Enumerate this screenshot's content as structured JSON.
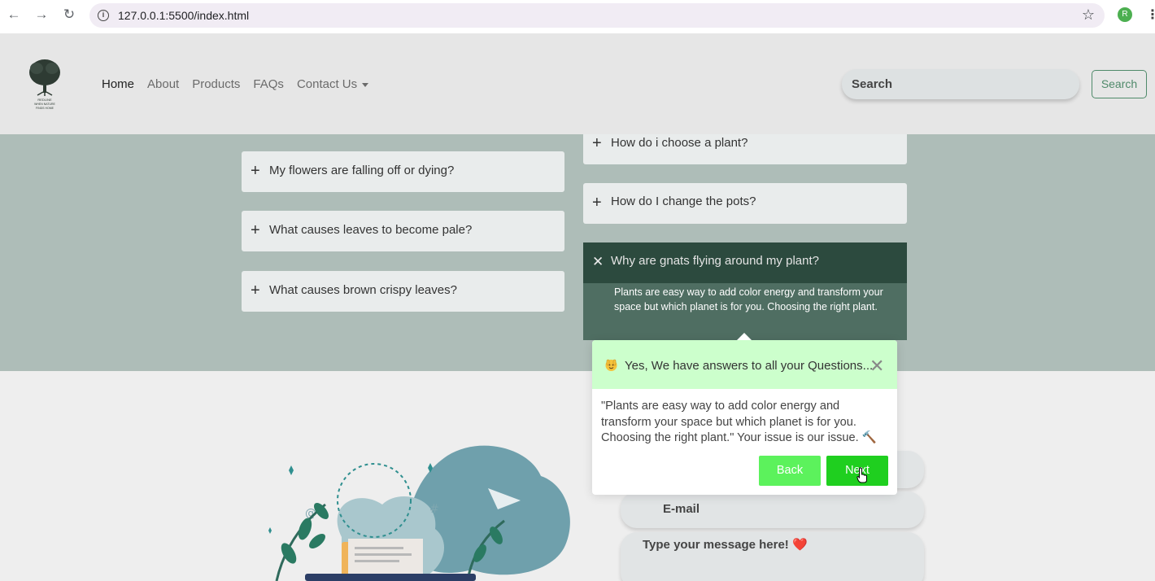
{
  "browser": {
    "url": "127.0.0.1:5500/index.html",
    "profile_initial": "R"
  },
  "nav": {
    "logo_text_1": "REDLINE",
    "logo_text_2": "WHEN NATURE",
    "logo_text_3": "FINDS HOME",
    "links": [
      "Home",
      "About",
      "Products",
      "FAQs",
      "Contact Us"
    ],
    "search_placeholder": "Search",
    "search_button": "Search"
  },
  "faqs": {
    "left": [
      "My flowers are falling off or dying?",
      "What causes leaves to become pale?",
      "What causes brown crispy leaves?"
    ],
    "right": [
      "How do i choose a plant?",
      "How do I change the pots?"
    ],
    "open_question": "Why are gnats flying around my plant?",
    "open_answer": "Plants are easy way to add color energy and transform your space but which planet is for you. Choosing the right plant."
  },
  "contact": {
    "email_placeholder": "E-mail",
    "message_placeholder": "Type your message here! ❤️"
  },
  "tour": {
    "title": "Yes, We have answers to all your Questions...",
    "body": "\"Plants are easy way to add color energy and transform your space but which planet is for you. Choosing the right plant.\" Your issue is our issue. 🔨",
    "back_label": "Back",
    "next_label": "Next",
    "colors": {
      "header_bg": "#ccffcc",
      "back_bg": "#5cf25c",
      "next_bg": "#1fcf1f"
    }
  }
}
